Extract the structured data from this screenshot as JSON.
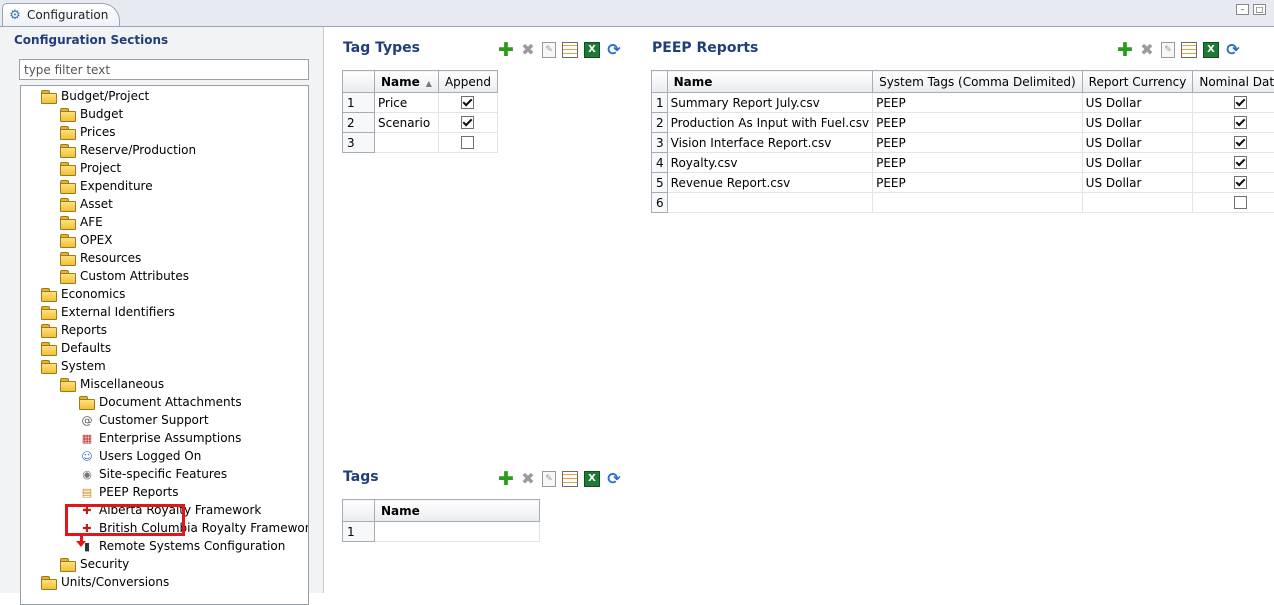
{
  "tab": {
    "title": "Configuration"
  },
  "sidebar": {
    "title": "Configuration Sections",
    "filter_placeholder": "type filter text",
    "items": [
      {
        "label": "Budget/Project",
        "icon": "folder-icon"
      },
      {
        "label": "Budget",
        "icon": "folder-icon"
      },
      {
        "label": "Prices",
        "icon": "folder-icon"
      },
      {
        "label": "Reserve/Production",
        "icon": "folder-icon"
      },
      {
        "label": "Project",
        "icon": "folder-icon"
      },
      {
        "label": "Expenditure",
        "icon": "folder-icon"
      },
      {
        "label": "Asset",
        "icon": "folder-icon"
      },
      {
        "label": "AFE",
        "icon": "folder-icon"
      },
      {
        "label": "OPEX",
        "icon": "folder-icon"
      },
      {
        "label": "Resources",
        "icon": "folder-icon"
      },
      {
        "label": "Custom Attributes",
        "icon": "folder-icon"
      },
      {
        "label": "Economics",
        "icon": "folder-icon"
      },
      {
        "label": "External Identifiers",
        "icon": "folder-icon"
      },
      {
        "label": "Reports",
        "icon": "folder-icon"
      },
      {
        "label": "Defaults",
        "icon": "folder-icon"
      },
      {
        "label": "System",
        "icon": "folder-icon"
      },
      {
        "label": "Miscellaneous",
        "icon": "folder-icon"
      },
      {
        "label": "Document Attachments",
        "icon": "folder-open-icon"
      },
      {
        "label": "Customer Support",
        "icon": "at-icon"
      },
      {
        "label": "Enterprise Assumptions",
        "icon": "calendar-icon"
      },
      {
        "label": "Users Logged On",
        "icon": "users-icon"
      },
      {
        "label": "Site-specific Features",
        "icon": "site-icon"
      },
      {
        "label": "PEEP Reports",
        "icon": "report-icon"
      },
      {
        "label": "Alberta Royalty Framework",
        "icon": "royalty-icon"
      },
      {
        "label": "British Columbia Royalty Framework",
        "icon": "royalty-icon"
      },
      {
        "label": "Remote Systems Configuration",
        "icon": "remote-icon"
      },
      {
        "label": "Security",
        "icon": "folder-icon"
      },
      {
        "label": "Units/Conversions",
        "icon": "folder-icon"
      }
    ]
  },
  "tag_types": {
    "title": "Tag Types",
    "columns": [
      "Name",
      "Append"
    ],
    "rows": [
      {
        "num": "1",
        "name": "Price",
        "append": true
      },
      {
        "num": "2",
        "name": "Scenario",
        "append": true
      },
      {
        "num": "3",
        "name": "",
        "append": false
      }
    ]
  },
  "tags": {
    "title": "Tags",
    "columns": [
      "Name"
    ],
    "rows": [
      {
        "num": "1",
        "name": ""
      }
    ]
  },
  "peep_reports": {
    "title": "PEEP Reports",
    "columns": [
      "Name",
      "System Tags (Comma Delimited)",
      "Report Currency",
      "Nominal Data"
    ],
    "rows": [
      {
        "num": "1",
        "name": "Summary Report July.csv",
        "tags": "PEEP",
        "currency": "US Dollar",
        "nominal": true
      },
      {
        "num": "2",
        "name": "Production As Input with Fuel.csv",
        "tags": "PEEP",
        "currency": "US Dollar",
        "nominal": true
      },
      {
        "num": "3",
        "name": "Vision Interface Report.csv",
        "tags": "PEEP",
        "currency": "US Dollar",
        "nominal": true
      },
      {
        "num": "4",
        "name": "Royalty.csv",
        "tags": "PEEP",
        "currency": "US Dollar",
        "nominal": true
      },
      {
        "num": "5",
        "name": "Revenue Report.csv",
        "tags": "PEEP",
        "currency": "US Dollar",
        "nominal": true
      },
      {
        "num": "6",
        "name": "",
        "tags": "",
        "currency": "",
        "nominal": false
      }
    ]
  },
  "toolbar_icons": [
    "add-icon",
    "delete-icon",
    "edit-icon",
    "grid-icon",
    "excel-icon",
    "refresh-icon"
  ],
  "colors": {
    "title": "#1f3e7a",
    "highlight": "#e0161b"
  }
}
